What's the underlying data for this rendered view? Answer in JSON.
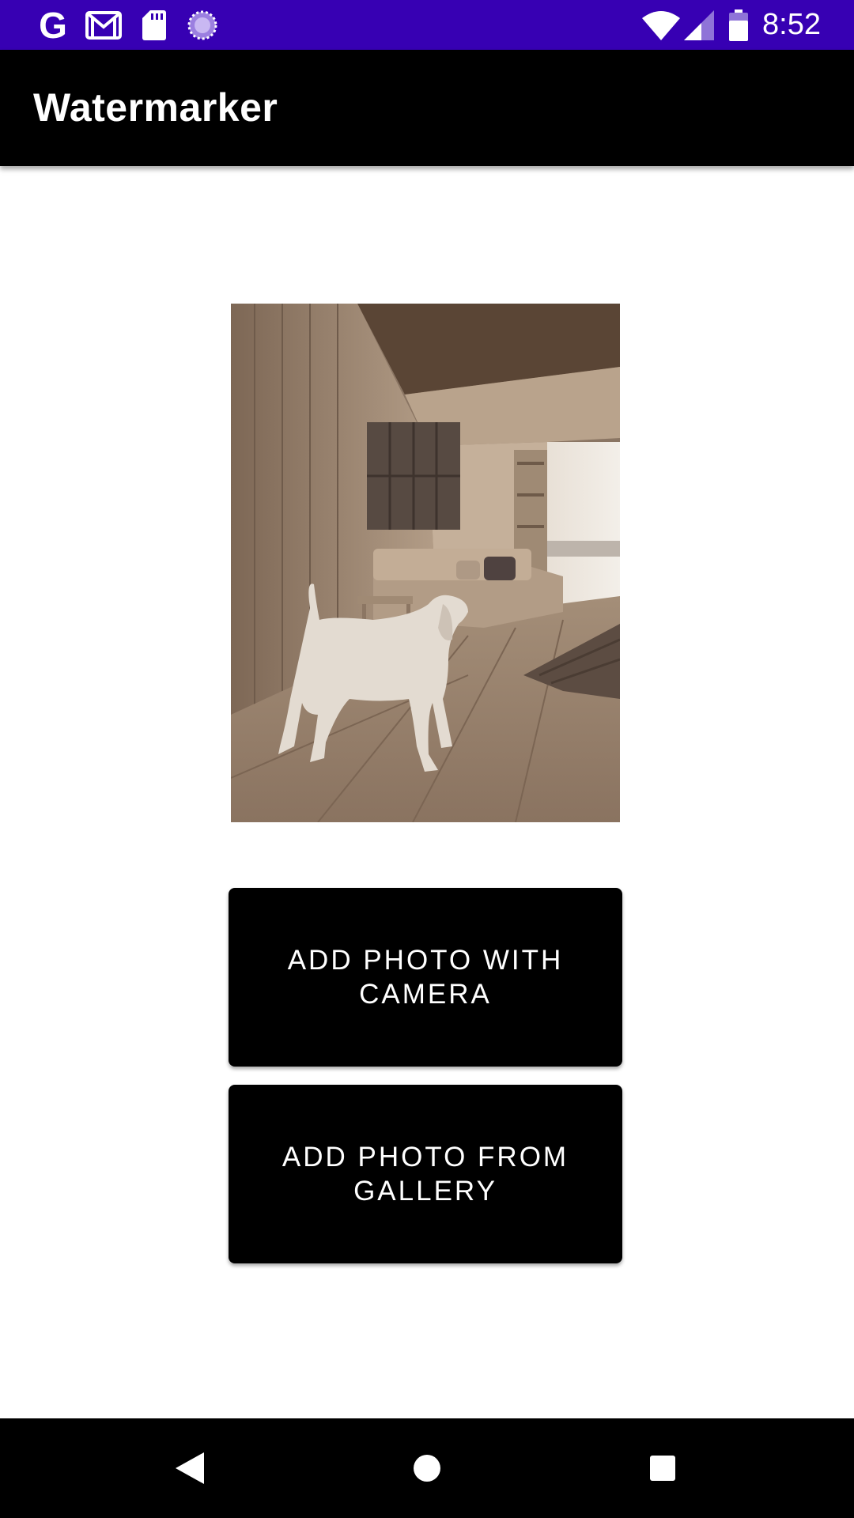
{
  "status_bar": {
    "time": "8:52",
    "icons": [
      "google-icon",
      "gmail-icon",
      "sd-card-icon",
      "loading-spinner-icon",
      "wifi-icon",
      "signal-icon",
      "battery-icon"
    ],
    "google_glyph": "G",
    "background_color": "#3700b3"
  },
  "app_bar": {
    "title": "Watermarker",
    "background_color": "#000000"
  },
  "main": {
    "photo": {
      "content": "image"
    },
    "buttons": {
      "camera_label": "ADD PHOTO WITH CAMERA",
      "gallery_label": "ADD PHOTO FROM GALLERY",
      "background_color": "#000000"
    }
  },
  "nav_bar": {
    "icons": [
      "back-icon",
      "home-icon",
      "recent-apps-icon"
    ]
  }
}
